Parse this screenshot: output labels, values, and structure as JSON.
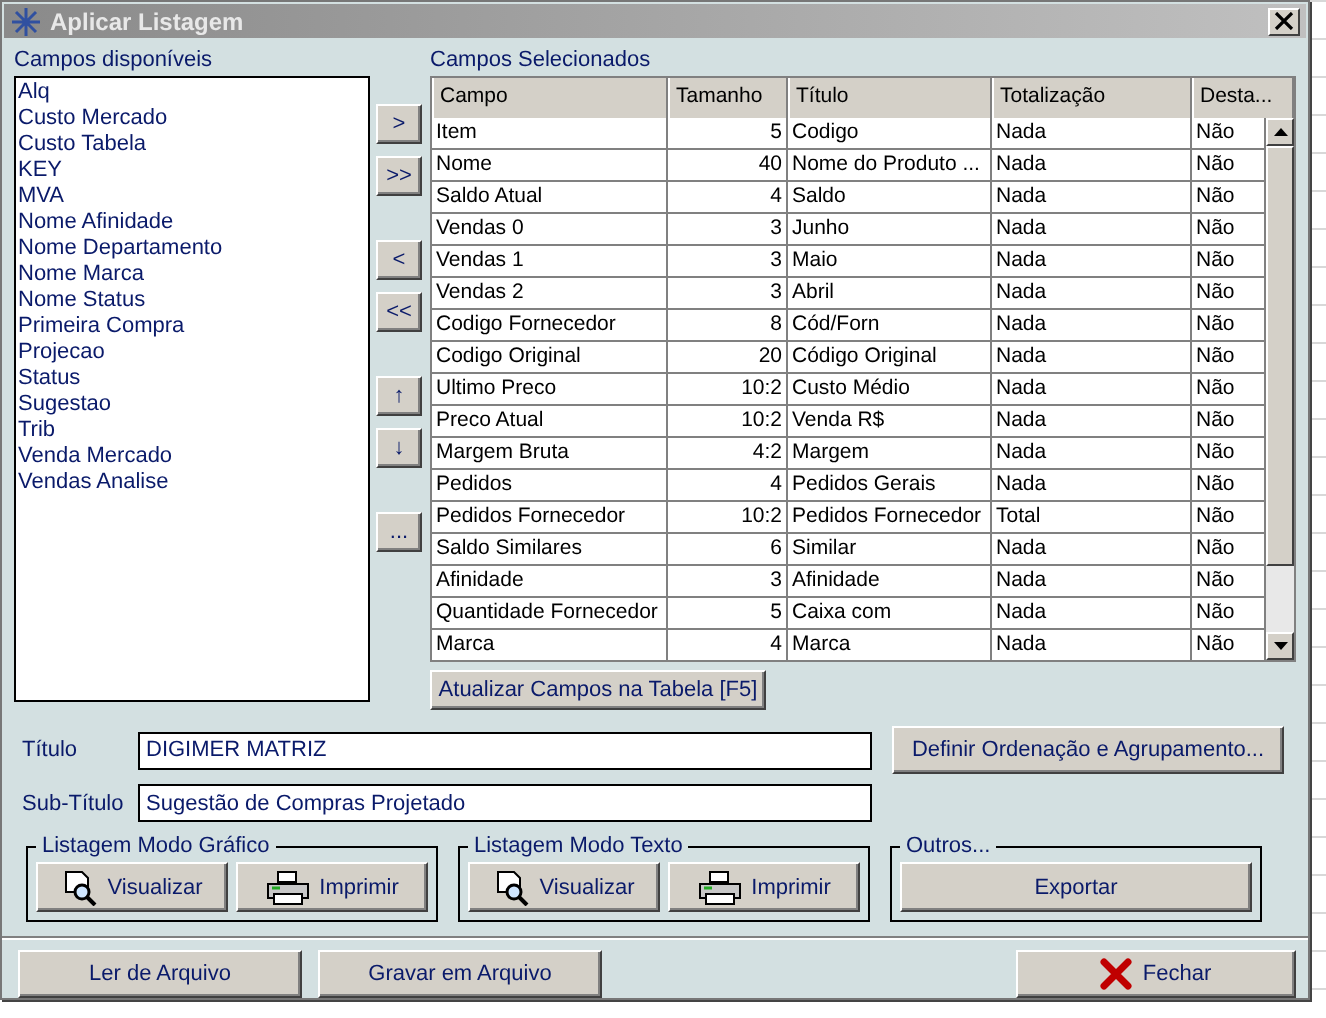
{
  "window": {
    "title": "Aplicar Listagem"
  },
  "available_fields": {
    "label": "Campos disponíveis",
    "items": [
      "Alq",
      "Custo Mercado",
      "Custo Tabela",
      "KEY",
      "MVA",
      "Nome Afinidade",
      "Nome Departamento",
      "Nome Marca",
      "Nome Status",
      "Primeira Compra",
      "Projecao",
      "Status",
      "Sugestao",
      "Trib",
      "Venda Mercado",
      "Vendas Analise"
    ]
  },
  "move_buttons": [
    [
      ">",
      ">>"
    ],
    [
      "<",
      "<<"
    ],
    [
      "↑",
      "↓"
    ],
    [
      "..."
    ]
  ],
  "selected_fields": {
    "label": "Campos Selecionados",
    "columns": [
      "Campo",
      "Tamanho",
      "Título",
      "Totalização",
      "Desta..."
    ],
    "rows": [
      [
        "Item",
        "5",
        "Codigo",
        "Nada",
        "Não"
      ],
      [
        "Nome",
        "40",
        "Nome do Produto ...",
        "Nada",
        "Não"
      ],
      [
        "Saldo Atual",
        "4",
        "Saldo",
        "Nada",
        "Não"
      ],
      [
        "Vendas 0",
        "3",
        "Junho",
        "Nada",
        "Não"
      ],
      [
        "Vendas 1",
        "3",
        "Maio",
        "Nada",
        "Não"
      ],
      [
        "Vendas 2",
        "3",
        "Abril",
        "Nada",
        "Não"
      ],
      [
        "Codigo Fornecedor",
        "8",
        "Cód/Forn",
        "Nada",
        "Não"
      ],
      [
        "Codigo Original",
        "20",
        "Código Original",
        "Nada",
        "Não"
      ],
      [
        "Ultimo Preco",
        "10:2",
        "Custo Médio",
        "Nada",
        "Não"
      ],
      [
        "Preco Atual",
        "10:2",
        "Venda R$",
        "Nada",
        "Não"
      ],
      [
        "Margem Bruta",
        "4:2",
        "Margem",
        "Nada",
        "Não"
      ],
      [
        "Pedidos",
        "4",
        "Pedidos Gerais",
        "Nada",
        "Não"
      ],
      [
        "Pedidos Fornecedor",
        "10:2",
        "Pedidos Fornecedor",
        "Total",
        "Não"
      ],
      [
        "Saldo Similares",
        "6",
        "Similar",
        "Nada",
        "Não"
      ],
      [
        "Afinidade",
        "3",
        "Afinidade",
        "Nada",
        "Não"
      ],
      [
        "Quantidade Fornecedor",
        "5",
        "Caixa com",
        "Nada",
        "Não"
      ],
      [
        "Marca",
        "4",
        "Marca",
        "Nada",
        "Não"
      ]
    ]
  },
  "update_button": "Atualizar Campos na Tabela [F5]",
  "title_field": {
    "label": "Título",
    "value": "DIGIMER MATRIZ"
  },
  "subtitle_field": {
    "label": "Sub-Título",
    "value": "Sugestão de Compras Projetado"
  },
  "order_button": "Definir Ordenação e Agrupamento...",
  "groups": [
    {
      "label": "Listagem Modo Gráfico",
      "buttons": [
        {
          "label": "Visualizar",
          "kind": "preview"
        },
        {
          "label": "Imprimir",
          "kind": "printer"
        }
      ]
    },
    {
      "label": "Listagem Modo Texto",
      "buttons": [
        {
          "label": "Visualizar",
          "kind": "preview"
        },
        {
          "label": "Imprimir",
          "kind": "printer"
        }
      ]
    },
    {
      "label": "Outros...",
      "buttons": [
        {
          "label": "Exportar",
          "kind": "plain"
        }
      ]
    }
  ],
  "footer_buttons": [
    {
      "label": "Ler de Arquivo",
      "kind": "plain"
    },
    {
      "label": "Gravar em Arquivo",
      "kind": "plain"
    },
    {
      "label": "Fechar",
      "kind": "close"
    }
  ]
}
